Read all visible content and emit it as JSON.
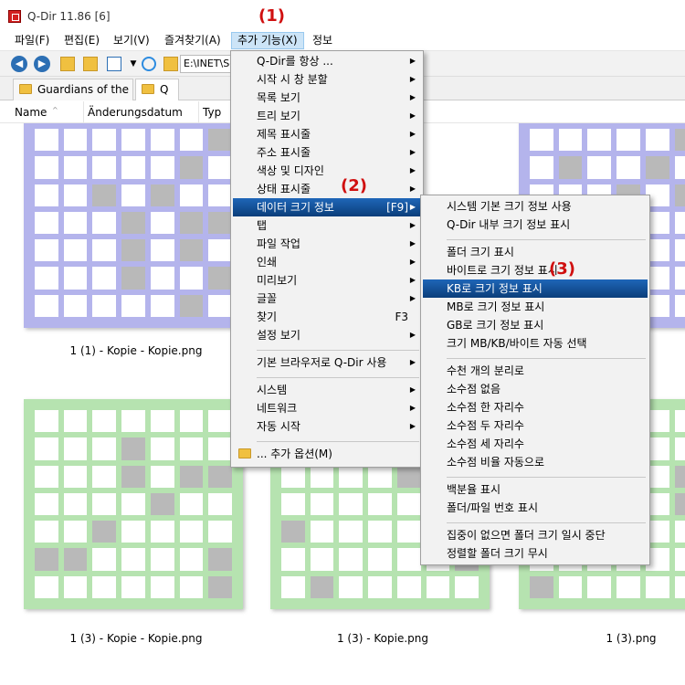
{
  "window": {
    "title": "Q-Dir 11.86 [6]"
  },
  "menubar": {
    "items": [
      {
        "label": "파일(F)"
      },
      {
        "label": "편집(E)"
      },
      {
        "label": "보기(V)"
      },
      {
        "label": "즐겨찾기(A)"
      },
      {
        "label": "추가 기능(X)"
      },
      {
        "label": "정보"
      }
    ]
  },
  "toolbar": {
    "address": "E:\\INET\\Sc"
  },
  "tabs": [
    {
      "label": "Guardians of the ..."
    },
    {
      "label": "Q"
    }
  ],
  "columns": [
    {
      "label": "Name"
    },
    {
      "label": "Änderungsdatum"
    },
    {
      "label": "Typ"
    }
  ],
  "files": [
    {
      "label": "1 (1) - Kopie - Kopie.png"
    },
    {
      "label": "1 (3) - Kopie - Kopie.png"
    },
    {
      "label": "1 (3) - Kopie.png"
    },
    {
      "label": "1 (3).png"
    }
  ],
  "colors": {
    "purple_tile": "#b4b4ec",
    "green_tile": "#b6e3b0",
    "highlight": "#0f4c91",
    "annotation": "#d01010"
  },
  "annotations": {
    "one": "(1)",
    "two": "(2)",
    "three": "(3)"
  },
  "menu_main": {
    "items": [
      {
        "label": "Q-Dir를 항상 ..."
      },
      {
        "label": "시작 시 창 분할"
      },
      {
        "label": "목록 보기"
      },
      {
        "label": "트리 보기"
      },
      {
        "label": "제목 표시줄"
      },
      {
        "label": "주소 표시줄"
      },
      {
        "label": "색상 및 디자인"
      },
      {
        "label": "상태 표시줄"
      },
      {
        "label": "데이터 크기 정보",
        "shortcut": "[F9]"
      },
      {
        "label": "탭"
      },
      {
        "label": "파일 작업"
      },
      {
        "label": "인쇄"
      },
      {
        "label": "미리보기"
      },
      {
        "label": "글꼴"
      },
      {
        "label": "찾기",
        "shortcut": "F3"
      },
      {
        "label": "설정 보기"
      },
      {
        "label": "기본 브라우저로 Q-Dir 사용"
      },
      {
        "label": "시스템"
      },
      {
        "label": "네트워크"
      },
      {
        "label": "자동 시작"
      },
      {
        "label": "... 추가 옵션(M)"
      }
    ]
  },
  "menu_sub": {
    "items": [
      {
        "label": "시스템 기본 크기 정보 사용"
      },
      {
        "label": "Q-Dir 내부 크기 정보 표시"
      },
      {
        "label": "폴더 크기 표시"
      },
      {
        "label": "바이트로 크기 정보 표시"
      },
      {
        "label": "KB로 크기 정보 표시"
      },
      {
        "label": "MB로 크기 정보 표시"
      },
      {
        "label": "GB로 크기 정보 표시"
      },
      {
        "label": "크기 MB/KB/바이트 자동 선택"
      },
      {
        "label": "수천 개의 분리로"
      },
      {
        "label": "소수점 없음"
      },
      {
        "label": "소수점 한 자리수"
      },
      {
        "label": "소수점 두 자리수"
      },
      {
        "label": "소수점 세 자리수"
      },
      {
        "label": "소수점 비율 자동으로"
      },
      {
        "label": "백분율 표시"
      },
      {
        "label": "폴더/파일 번호 표시"
      },
      {
        "label": "집중이 없으면 폴더 크기 일시 중단"
      },
      {
        "label": "정렬할 폴더 크기 무시"
      }
    ]
  }
}
